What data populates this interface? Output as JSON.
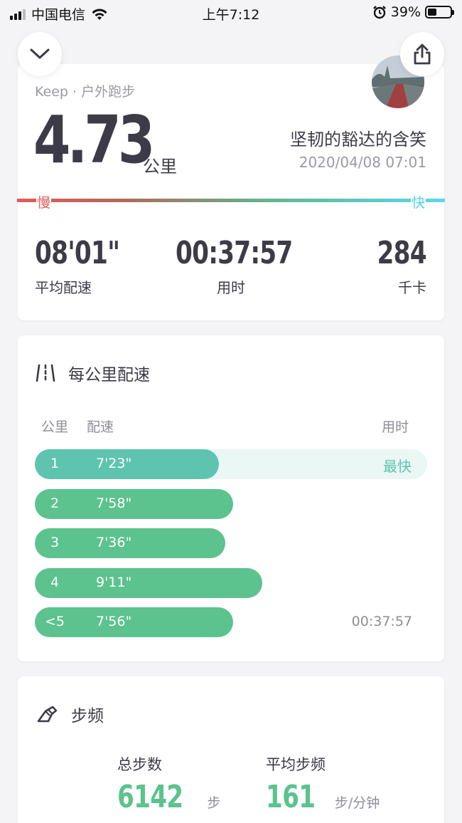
{
  "status_bar": {
    "carrier": "中国电信",
    "time": "上午7:12",
    "battery": "39%",
    "battery_level": 0.39
  },
  "summary": {
    "source": "Keep · 户外跑步",
    "distance": "4.73",
    "distance_unit": "公里",
    "username": "坚韧的豁达的含笑",
    "datetime": "2020/04/08 07:01",
    "slow_label": "慢",
    "fast_label": "快",
    "stats": [
      {
        "value": "08'01\"",
        "label": "平均配速"
      },
      {
        "value": "00:37:57",
        "label": "用时"
      },
      {
        "value": "284",
        "label": "千卡"
      }
    ]
  },
  "pace": {
    "title": "每公里配速",
    "headers": {
      "km": "公里",
      "pace": "配速",
      "time": "用时"
    },
    "rows": [
      {
        "km": "1",
        "pace": "7'23\"",
        "fraction": 0.47,
        "tag": "最快",
        "time": ""
      },
      {
        "km": "2",
        "pace": "7'58\"",
        "fraction": 0.505,
        "tag": "",
        "time": ""
      },
      {
        "km": "3",
        "pace": "7'36\"",
        "fraction": 0.485,
        "tag": "",
        "time": ""
      },
      {
        "km": "4",
        "pace": "9'11\"",
        "fraction": 0.58,
        "tag": "",
        "time": ""
      },
      {
        "km": "<5",
        "pace": "7'56\"",
        "fraction": 0.505,
        "tag": "",
        "time": "00:37:57"
      }
    ]
  },
  "cadence": {
    "title": "步频",
    "total_steps_label": "总步数",
    "total_steps": "6142",
    "total_steps_unit": "步",
    "avg_cadence_label": "平均步频",
    "avg_cadence": "161",
    "avg_cadence_unit": "步/分钟"
  },
  "colors": {
    "accent_green": "#5cc28e",
    "fastest_teal": "#5ec4b0",
    "slow_red": "#e25a59",
    "fast_blue": "#5dd7ec"
  },
  "icons": [
    "chevron-down-icon",
    "share-icon",
    "road-icon",
    "shoe-icon",
    "wifi-icon",
    "alarm-icon"
  ]
}
